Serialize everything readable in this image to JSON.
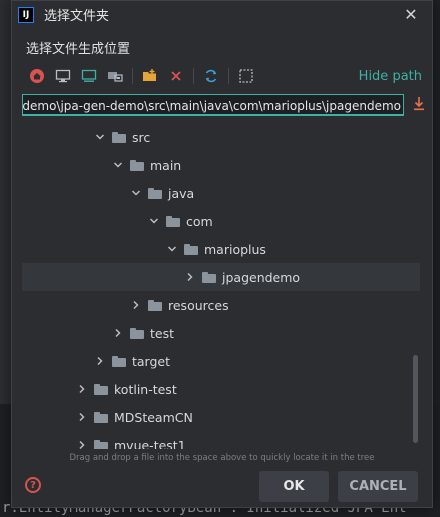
{
  "window": {
    "app_icon_text": "IJ",
    "title": "选择文件夹",
    "close_glyph": "✕"
  },
  "subtitle": "选择文件生成位置",
  "toolbar": {
    "icons": [
      "home-icon",
      "desktop-icon",
      "monitor-icon",
      "module-icon",
      "new-folder-icon",
      "delete-icon",
      "refresh-icon",
      "show-hidden-icon"
    ],
    "hide_path_label": "Hide path"
  },
  "path_field": {
    "value": "demo\\jpa-gen-demo\\src\\main\\java\\com\\marioplus\\jpagendemo"
  },
  "tree": {
    "rows": [
      {
        "label": "src",
        "expanded": true
      },
      {
        "label": "main",
        "expanded": true
      },
      {
        "label": "java",
        "expanded": true
      },
      {
        "label": "com",
        "expanded": true
      },
      {
        "label": "marioplus",
        "expanded": true
      },
      {
        "label": "jpagendemo",
        "expanded": false,
        "selected": true
      },
      {
        "label": "resources",
        "expanded": false
      },
      {
        "label": "test",
        "expanded": false
      },
      {
        "label": "target",
        "expanded": false
      },
      {
        "label": "kotlin-test",
        "expanded": false
      },
      {
        "label": "MDSteamCN",
        "expanded": false
      },
      {
        "label": "mvue-test1",
        "expanded": false
      }
    ]
  },
  "hint": "Drag and drop a file into the space above to quickly locate it in the tree",
  "footer": {
    "help_glyph": "?",
    "ok_label": "OK",
    "cancel_label": "CANCEL"
  },
  "background": {
    "bottom_line": "r.EntityManagerFactoryBean : Initialized JPA Ent"
  },
  "colors": {
    "accent": "#3fb0a3",
    "dialog_bg": "#2b2d30",
    "danger": "#d9534f"
  }
}
